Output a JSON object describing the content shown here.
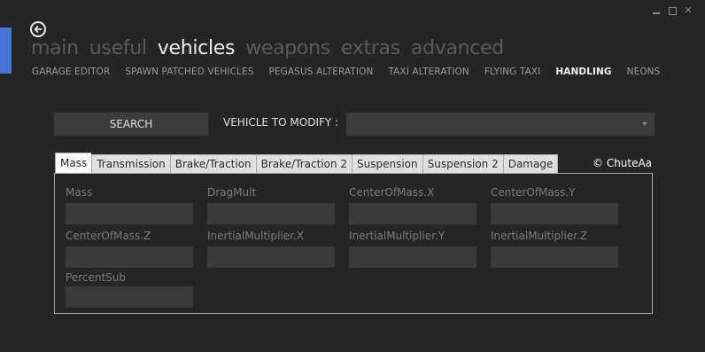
{
  "window_controls": {
    "minimize": "minimize",
    "maximize": "maximize",
    "close": "✕"
  },
  "main_tabs": [
    {
      "label": "main"
    },
    {
      "label": "useful"
    },
    {
      "label": "vehicles"
    },
    {
      "label": "weapons"
    },
    {
      "label": "extras"
    },
    {
      "label": "advanced"
    }
  ],
  "active_main_tab": "vehicles",
  "sub_tabs": [
    {
      "label": "GARAGE EDITOR"
    },
    {
      "label": "SPAWN PATCHED VEHICLES"
    },
    {
      "label": "PEGASUS ALTERATION"
    },
    {
      "label": "TAXI ALTERATION"
    },
    {
      "label": "FLYING TAXI"
    },
    {
      "label": "HANDLING"
    },
    {
      "label": "NEONS"
    }
  ],
  "active_sub_tab": "HANDLING",
  "search_button": "SEARCH",
  "vehicle_label": "VEHICLE TO MODIFY :",
  "vehicle_select_value": "",
  "handling_tabs": [
    {
      "label": "Mass"
    },
    {
      "label": "Transmission"
    },
    {
      "label": "Brake/Traction"
    },
    {
      "label": "Brake/Traction 2"
    },
    {
      "label": "Suspension"
    },
    {
      "label": "Suspension 2"
    },
    {
      "label": "Damage"
    }
  ],
  "active_handling_tab": "Mass",
  "credit": "© ChuteAa",
  "fields": [
    {
      "label": "Mass",
      "value": ""
    },
    {
      "label": "DragMult",
      "value": ""
    },
    {
      "label": "CenterOfMass.X",
      "value": ""
    },
    {
      "label": "CenterOfMass.Y",
      "value": ""
    },
    {
      "label": "CenterOfMass.Z",
      "value": ""
    },
    {
      "label": "InertialMultiplier.X",
      "value": ""
    },
    {
      "label": "InertialMultiplier.Y",
      "value": ""
    },
    {
      "label": "InertialMultiplier.Z",
      "value": ""
    },
    {
      "label": "PercentSub",
      "value": ""
    }
  ],
  "colors": {
    "accent": "#4a73d6",
    "background": "#252525",
    "input": "#3a3a3a"
  },
  "icons": {
    "back": "back-arrow-icon",
    "dropdown": "chevron-down-icon"
  }
}
